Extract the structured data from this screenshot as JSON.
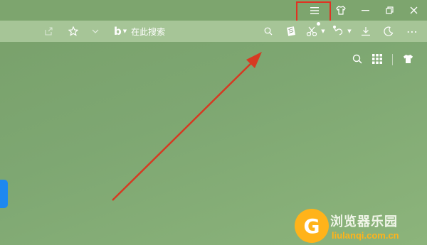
{
  "titlebar": {
    "buttons": [
      {
        "name": "menu",
        "icon": "hamburger-menu-icon",
        "glyph": "≡"
      },
      {
        "name": "skin",
        "icon": "shirt-icon",
        "glyph": "👕"
      },
      {
        "name": "minimize",
        "icon": "minimize-icon",
        "glyph": "—"
      },
      {
        "name": "restore",
        "icon": "restore-icon",
        "glyph": "❐"
      },
      {
        "name": "close",
        "icon": "close-icon",
        "glyph": "✕"
      }
    ]
  },
  "toolbar": {
    "search_placeholder": "在此搜索",
    "search_engine_glyph": "b",
    "more_glyph": "⋯"
  },
  "watermark": {
    "cn_text": "浏览器乐园",
    "en_text": "liulanqi.com.cn"
  },
  "colors": {
    "background": "#7ea772",
    "toolbar": "#a6c597",
    "highlight": "#e03222",
    "arrow": "#d63a22",
    "side_tab": "#1e88f0",
    "watermark_accent": "#ffb31a"
  }
}
